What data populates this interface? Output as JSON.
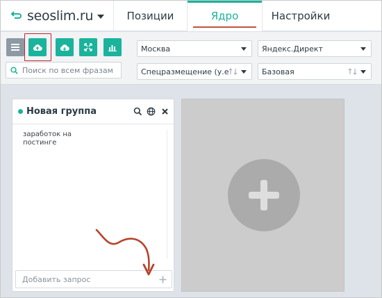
{
  "header": {
    "brand": "seoslim.ru",
    "tabs": [
      {
        "label": "Позиции"
      },
      {
        "label": "Ядро",
        "active": true
      },
      {
        "label": "Настройки"
      }
    ]
  },
  "toolbar": {
    "search_placeholder": "Поиск по всем фразам",
    "region": "Москва",
    "engine": "Яндекс.Директ",
    "special": "Спецразмещение (у.е.)",
    "base": "Базовая",
    "buttons": [
      {
        "icon": "menu-icon"
      },
      {
        "icon": "cloud-upload-icon",
        "highlighted": true
      },
      {
        "icon": "cloud-download-icon"
      },
      {
        "icon": "expand-icon"
      },
      {
        "icon": "bar-chart-icon"
      }
    ]
  },
  "group": {
    "title": "Новая группа",
    "phrases": [
      "заработок на постинге"
    ],
    "add_placeholder": "Добавить запрос"
  },
  "colors": {
    "accent": "#1bb39c",
    "annotation": "#b5432a",
    "highlight_border": "#c0252b",
    "tile": "#cccccc"
  }
}
